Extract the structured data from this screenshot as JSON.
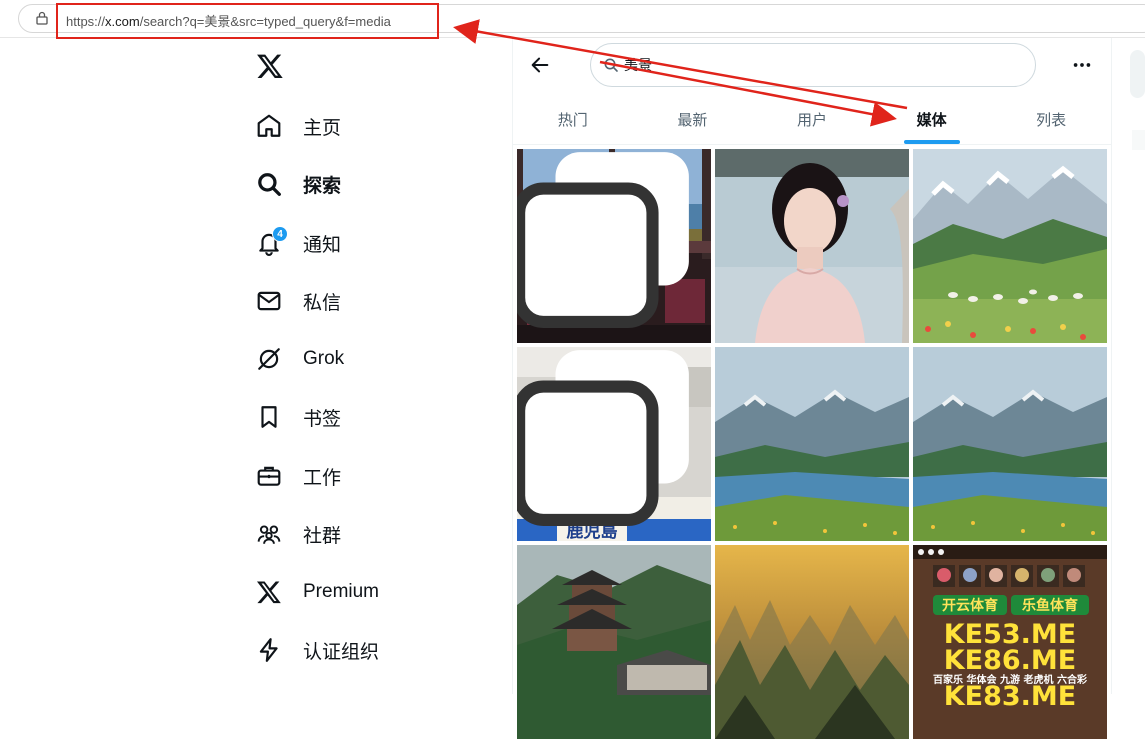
{
  "browser": {
    "url_prefix": "https://",
    "url_host": "x.com",
    "url_rest": "/search?q=美景&src=typed_query&f=media"
  },
  "nav": {
    "items": [
      {
        "label": "主页",
        "icon": "home-icon"
      },
      {
        "label": "探索",
        "icon": "search-icon",
        "active": true
      },
      {
        "label": "通知",
        "icon": "bell-icon",
        "badge": "4"
      },
      {
        "label": "私信",
        "icon": "mail-icon"
      },
      {
        "label": "Grok",
        "icon": "grok-icon"
      },
      {
        "label": "书签",
        "icon": "bookmark-icon"
      },
      {
        "label": "工作",
        "icon": "briefcase-icon"
      },
      {
        "label": "社群",
        "icon": "communities-icon"
      },
      {
        "label": "Premium",
        "icon": "x-logo-icon"
      },
      {
        "label": "认证组织",
        "icon": "lightning-icon"
      }
    ]
  },
  "search": {
    "query": "美景"
  },
  "tabs": [
    {
      "label": "热门"
    },
    {
      "label": "最新"
    },
    {
      "label": "用户"
    },
    {
      "label": "媒体",
      "active": true
    },
    {
      "label": "列表"
    }
  ],
  "media": {
    "tiles": [
      {
        "subject": "room-with-lake-view",
        "multi": true
      },
      {
        "subject": "woman-in-qipao",
        "multi": false
      },
      {
        "subject": "mountain-meadow-sheep",
        "multi": false
      },
      {
        "subject": "kitchen-worker",
        "multi": true
      },
      {
        "subject": "mountain-lake",
        "multi": false
      },
      {
        "subject": "mountain-lake",
        "multi": false
      },
      {
        "subject": "pagoda-forest",
        "multi": false
      },
      {
        "subject": "karst-sunset",
        "multi": false
      },
      {
        "subject": "sports-promo",
        "multi": false
      }
    ],
    "promo": {
      "badge1": "开云体育",
      "badge2": "乐鱼体育",
      "line1": "KE53.ME",
      "line2": "KE86.ME",
      "footer": "百家乐 华体会 九游 老虎机 六合彩",
      "line3": "KE83.ME"
    },
    "kitchen_sign": "鹿児島"
  },
  "colors": {
    "accent": "#1d9bf0",
    "annotation": "#e0241b"
  }
}
